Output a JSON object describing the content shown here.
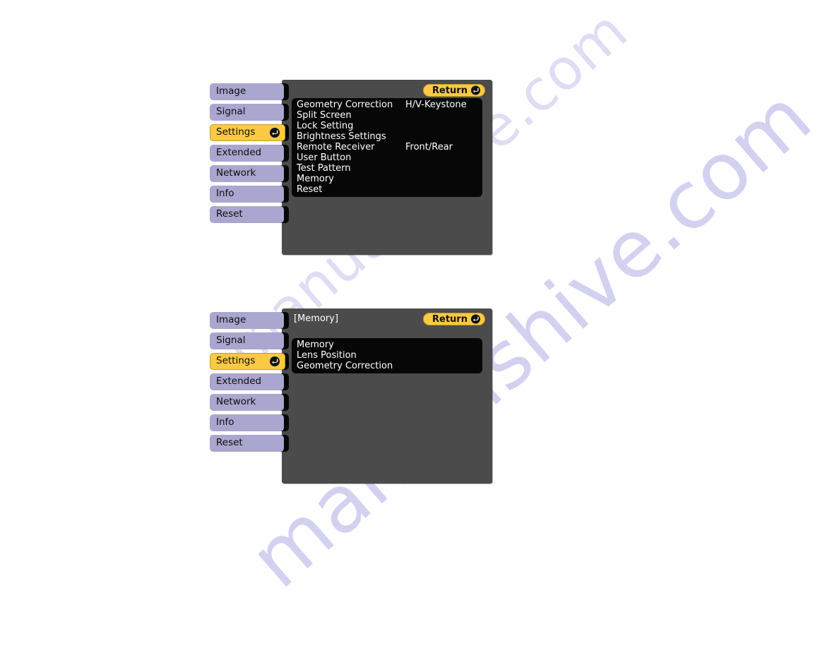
{
  "page": {
    "background_color": "#ffffff",
    "watermark_text": "manualshive.com",
    "watermark_color": "#b9b6e8"
  },
  "theme": {
    "panel_gray": "#4b4b4b",
    "list_black": "#070707",
    "sidebar_lavender": "#a9a6cf",
    "accent_yellow": "#fbc943",
    "text_white": "#ffffff",
    "text_black": "#0c0c0c"
  },
  "sidebar": {
    "items": [
      {
        "label": "Image",
        "active": false
      },
      {
        "label": "Signal",
        "active": false
      },
      {
        "label": "Settings",
        "active": true
      },
      {
        "label": "Extended",
        "active": false
      },
      {
        "label": "Network",
        "active": false
      },
      {
        "label": "Info",
        "active": false
      },
      {
        "label": "Reset",
        "active": false
      }
    ]
  },
  "screens": [
    {
      "id": "settings-menu",
      "title": "",
      "return_label": "Return",
      "return_icon": "enter-arrow-icon",
      "rows": [
        {
          "label": "Geometry Correction",
          "value": "H/V-Keystone"
        },
        {
          "label": "Split Screen",
          "value": ""
        },
        {
          "label": "Lock Setting",
          "value": ""
        },
        {
          "label": "Brightness Settings",
          "value": ""
        },
        {
          "label": "Remote Receiver",
          "value": "Front/Rear"
        },
        {
          "label": "User Button",
          "value": ""
        },
        {
          "label": "Test Pattern",
          "value": ""
        },
        {
          "label": "Memory",
          "value": ""
        },
        {
          "label": "Reset",
          "value": ""
        }
      ]
    },
    {
      "id": "memory-submenu",
      "title": "[Memory]",
      "return_label": "Return",
      "return_icon": "enter-arrow-icon",
      "rows": [
        {
          "label": "Memory",
          "value": ""
        },
        {
          "label": "Lens Position",
          "value": ""
        },
        {
          "label": "Geometry Correction",
          "value": ""
        }
      ]
    }
  ]
}
